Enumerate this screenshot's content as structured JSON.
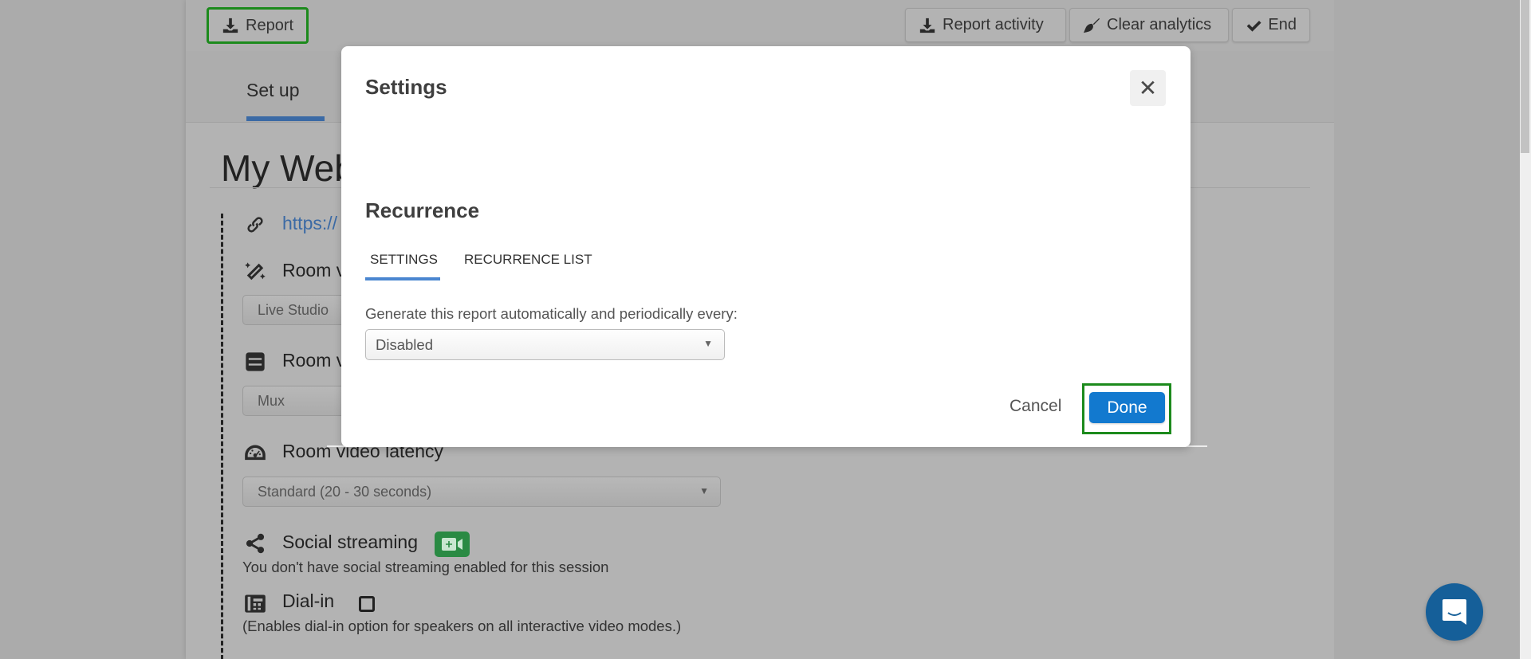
{
  "toolbar": {
    "report_label": "Report",
    "report_activity_label": "Report activity",
    "clear_analytics_label": "Clear analytics",
    "end_label": "End"
  },
  "tabs": {
    "setup_label": "Set up"
  },
  "page": {
    "title": "My Web",
    "link_text": "https://",
    "room_v1_label": "Room v",
    "room_v1_value": "Live Studio",
    "room_v2_label": "Room v",
    "room_v2_value": "Mux",
    "latency_label": "Room video latency",
    "latency_value": "Standard (20 - 30 seconds)",
    "social_label": "Social streaming",
    "social_help": "You don't have social streaming enabled for this session",
    "dialin_label": "Dial-in",
    "dialin_checked": false,
    "dialin_help": "(Enables dial-in option for speakers on all interactive video modes.)"
  },
  "modal": {
    "title": "Settings",
    "close_symbol": "✕",
    "section_title": "Recurrence",
    "tabs": [
      {
        "label": "SETTINGS",
        "active": true
      },
      {
        "label": "RECURRENCE LIST",
        "active": false
      }
    ],
    "generate_label": "Generate this report automatically and periodically every:",
    "recurrence_select_value": "Disabled",
    "cancel_label": "Cancel",
    "done_label": "Done"
  },
  "colors": {
    "primary": "#1279cf",
    "highlight_outline": "#1c8a1c",
    "tab_accent": "#4a86d0",
    "chat_bubble": "#155f99",
    "social_badge": "#2a8a43"
  },
  "icons": {
    "report": "download-icon",
    "report_activity": "download-icon",
    "clear_analytics": "broom-icon",
    "end": "check-icon",
    "link": "link-icon",
    "room_v1": "magic-wand-icon",
    "room_v2": "server-icon",
    "latency": "gauge-icon",
    "social": "share-icon",
    "social_badge": "video-plus-icon",
    "dialin": "fax-phone-icon",
    "chat": "chat-icon"
  }
}
